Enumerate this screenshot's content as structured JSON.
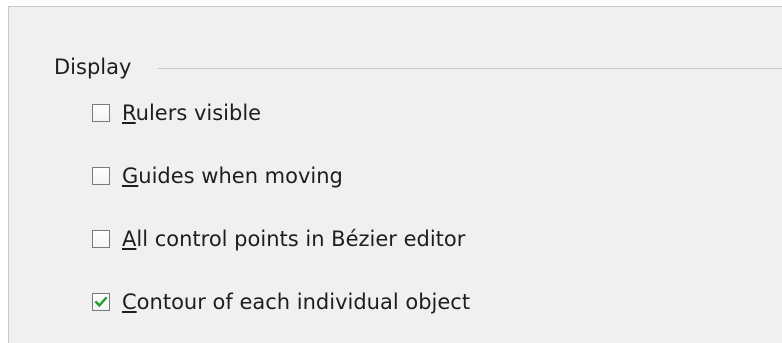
{
  "group": {
    "title": "Display"
  },
  "options": [
    {
      "mnemonic": "R",
      "rest": "ulers visible",
      "checked": false
    },
    {
      "mnemonic": "G",
      "rest": "uides when moving",
      "checked": false
    },
    {
      "mnemonic": "A",
      "rest": "ll control points in Bézier editor",
      "checked": false
    },
    {
      "mnemonic": "C",
      "rest": "ontour of each individual object",
      "checked": true
    }
  ],
  "colors": {
    "checkmark": "#1e9e2a",
    "panel_bg": "#f0f0f0"
  },
  "icons": {
    "checked": "checkmark-icon"
  }
}
